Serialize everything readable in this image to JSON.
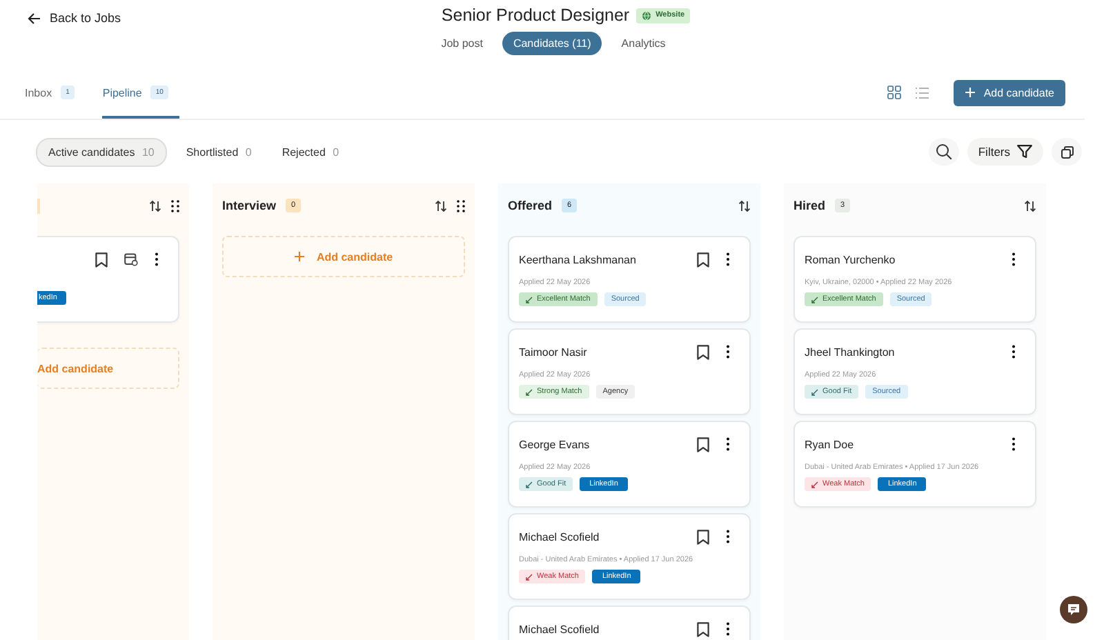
{
  "back_link": "Back to Jobs",
  "job": {
    "title": "Senior Product Designer",
    "source": "Website"
  },
  "view_tabs": [
    {
      "label": "Job post",
      "selected": false
    },
    {
      "label": "Candidates (11)",
      "selected": true
    },
    {
      "label": "Analytics",
      "selected": false
    }
  ],
  "tabs": [
    {
      "label": "Inbox",
      "count": "1",
      "selected": false
    },
    {
      "label": "Pipeline",
      "count": "10",
      "selected": true
    }
  ],
  "view_modes": [
    {
      "kind": "grid",
      "selected": true
    },
    {
      "kind": "list",
      "selected": false
    }
  ],
  "add_candidate_button": "Add candidate",
  "filters": [
    {
      "label": "Active candidates",
      "count": "10",
      "selected": true
    },
    {
      "label": "Shortlisted",
      "count": "0",
      "selected": false
    },
    {
      "label": "Rejected",
      "count": "0",
      "selected": false
    }
  ],
  "filters_button": "Filters",
  "columns": [
    {
      "color": "#fde3bd",
      "draggable": true,
      "cards": [
        {
          "tags": [
            {
              "label": "kedIn",
              "kind": "linkedin"
            }
          ],
          "bookmark": true,
          "calendar": true
        }
      ],
      "add": {
        "label": "Add candidate",
        "plus": false
      }
    },
    {
      "title": "Interview",
      "count": "0",
      "color": "#fde3bd",
      "draggable": true,
      "add": {
        "label": "Add candidate",
        "plus": true
      }
    },
    {
      "title": "Offered",
      "count": "6",
      "color": "#cfe8f8",
      "draggable": false,
      "cards": [
        {
          "name": "Keerthana Lakshmanan",
          "meta": "Applied 22 May 2026",
          "bookmark": true,
          "calendar": false,
          "tags": [
            {
              "label": "Excellent Match",
              "kind": "excellent"
            },
            {
              "label": "Sourced",
              "kind": "sourced"
            }
          ]
        },
        {
          "name": "Taimoor Nasir",
          "meta": "Applied 22 May 2026",
          "bookmark": true,
          "calendar": false,
          "tags": [
            {
              "label": "Strong Match",
              "kind": "strong"
            },
            {
              "label": "Agency",
              "kind": "agency"
            }
          ]
        },
        {
          "name": "George Evans",
          "meta": "Applied 22 May 2026",
          "bookmark": true,
          "calendar": false,
          "tags": [
            {
              "label": "Good Fit",
              "kind": "good"
            },
            {
              "label": "LinkedIn",
              "kind": "linkedin"
            }
          ]
        },
        {
          "name": "Michael Scofield",
          "meta": "Dubai - United Arab Emirates • Applied 17 Jun 2026",
          "bookmark": true,
          "calendar": false,
          "tags": [
            {
              "label": "Weak Match",
              "kind": "weak"
            },
            {
              "label": "LinkedIn",
              "kind": "linkedin"
            }
          ]
        },
        {
          "name": "Michael Scofield",
          "bookmark": true,
          "calendar": false
        }
      ]
    },
    {
      "title": "Hired",
      "count": "3",
      "color": "#e8ebe8",
      "draggable": false,
      "cards": [
        {
          "name": "Roman Yurchenko",
          "meta": "Kyiv, Ukraine, 02000 • Applied 22 May 2026",
          "bookmark": false,
          "calendar": false,
          "tags": [
            {
              "label": "Excellent Match",
              "kind": "excellent"
            },
            {
              "label": "Sourced",
              "kind": "sourced"
            }
          ]
        },
        {
          "name": "Jheel Thankington",
          "meta": "Applied 22 May 2026",
          "bookmark": false,
          "calendar": false,
          "tags": [
            {
              "label": "Good Fit",
              "kind": "good"
            },
            {
              "label": "Sourced",
              "kind": "sourced"
            }
          ]
        },
        {
          "name": "Ryan Doe",
          "meta": "Dubai - United Arab Emirates • Applied 17 Jun 2026",
          "bookmark": false,
          "calendar": false,
          "tags": [
            {
              "label": "Weak Match",
              "kind": "weak"
            },
            {
              "label": "LinkedIn",
              "kind": "linkedin"
            }
          ]
        }
      ]
    }
  ]
}
